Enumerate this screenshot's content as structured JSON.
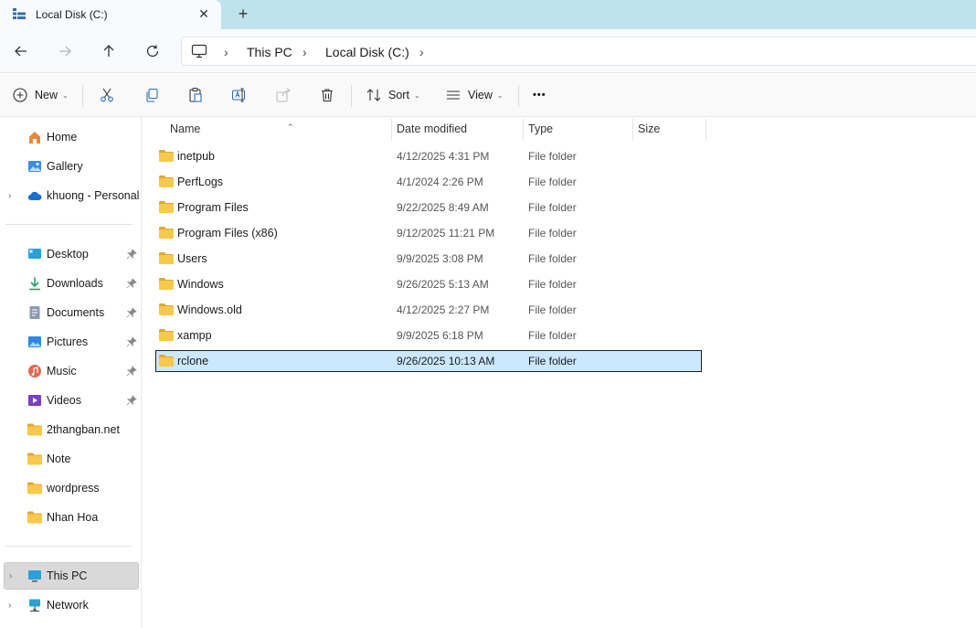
{
  "window": {
    "tab_title": "Local Disk (C:)",
    "close_tab": "✕",
    "new_tab": "+"
  },
  "address": {
    "crumbs": [
      "This PC",
      "Local Disk (C:)"
    ],
    "separator": "›"
  },
  "commands": {
    "new_label": "New",
    "sort_label": "Sort",
    "view_label": "View",
    "more_label": "•••"
  },
  "sidebar": {
    "top": [
      {
        "label": "Home",
        "icon": "home-icon"
      },
      {
        "label": "Gallery",
        "icon": "gallery-icon"
      },
      {
        "label": "khuong - Personal",
        "icon": "onedrive-icon"
      }
    ],
    "quick_access": [
      {
        "label": "Desktop",
        "icon": "desktop-icon",
        "pinned": true
      },
      {
        "label": "Downloads",
        "icon": "downloads-icon",
        "pinned": true
      },
      {
        "label": "Documents",
        "icon": "documents-icon",
        "pinned": true
      },
      {
        "label": "Pictures",
        "icon": "pictures-icon",
        "pinned": true
      },
      {
        "label": "Music",
        "icon": "music-icon",
        "pinned": true
      },
      {
        "label": "Videos",
        "icon": "videos-icon",
        "pinned": true
      },
      {
        "label": "2thangban.net",
        "icon": "folder-icon",
        "pinned": false
      },
      {
        "label": "Note",
        "icon": "folder-icon",
        "pinned": false
      },
      {
        "label": "wordpress",
        "icon": "folder-icon",
        "pinned": false
      },
      {
        "label": "Nhan Hoa",
        "icon": "folder-icon",
        "pinned": false
      }
    ],
    "bottom": [
      {
        "label": "This PC",
        "icon": "this-pc-icon",
        "selected": true
      },
      {
        "label": "Network",
        "icon": "network-icon",
        "selected": false
      }
    ]
  },
  "columns": {
    "name": "Name",
    "date": "Date modified",
    "type": "Type",
    "size": "Size"
  },
  "files": [
    {
      "name": "inetpub",
      "date": "4/12/2025 4:31 PM",
      "type": "File folder",
      "selected": false
    },
    {
      "name": "PerfLogs",
      "date": "4/1/2024 2:26 PM",
      "type": "File folder",
      "selected": false
    },
    {
      "name": "Program Files",
      "date": "9/22/2025 8:49 AM",
      "type": "File folder",
      "selected": false
    },
    {
      "name": "Program Files (x86)",
      "date": "9/12/2025 11:21 PM",
      "type": "File folder",
      "selected": false
    },
    {
      "name": "Users",
      "date": "9/9/2025 3:08 PM",
      "type": "File folder",
      "selected": false
    },
    {
      "name": "Windows",
      "date": "9/26/2025 5:13 AM",
      "type": "File folder",
      "selected": false
    },
    {
      "name": "Windows.old",
      "date": "4/12/2025 2:27 PM",
      "type": "File folder",
      "selected": false
    },
    {
      "name": "xampp",
      "date": "9/9/2025 6:18 PM",
      "type": "File folder",
      "selected": false
    },
    {
      "name": "rclone",
      "date": "9/26/2025 10:13 AM",
      "type": "File folder",
      "selected": true
    }
  ],
  "colors": {
    "tab_strip": "#bfe3ec",
    "selection": "#cce8ff",
    "folder": "#f8c84a"
  }
}
